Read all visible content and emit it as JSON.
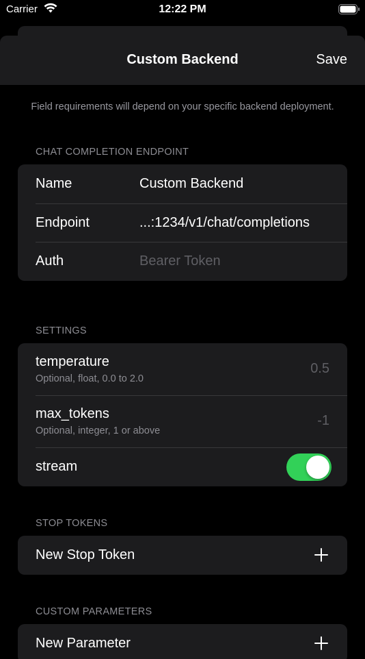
{
  "status_bar": {
    "carrier": "Carrier",
    "time": "12:22 PM"
  },
  "nav": {
    "title": "Custom Backend",
    "save_label": "Save"
  },
  "note": "Field requirements will depend on your specific backend deployment.",
  "endpoint_section": {
    "header": "CHAT COMPLETION ENDPOINT",
    "rows": [
      {
        "label": "Name",
        "value": "Custom Backend"
      },
      {
        "label": "Endpoint",
        "value": "...:1234/v1/chat/completions"
      },
      {
        "label": "Auth",
        "placeholder": "Bearer Token"
      }
    ]
  },
  "settings_section": {
    "header": "SETTINGS",
    "temperature": {
      "title": "temperature",
      "subtitle": "Optional, float, 0.0 to 2.0",
      "placeholder": "0.5"
    },
    "max_tokens": {
      "title": "max_tokens",
      "subtitle": "Optional, integer, 1 or above",
      "placeholder": "-1"
    },
    "stream": {
      "title": "stream",
      "enabled": true
    }
  },
  "stop_tokens_section": {
    "header": "STOP TOKENS",
    "add_label": "New Stop Token"
  },
  "custom_params_section": {
    "header": "CUSTOM PARAMETERS",
    "add_label": "New Parameter"
  },
  "colors": {
    "accent_toggle": "#32d158",
    "group_bg": "#1c1c1e",
    "secondary_text": "#8d8d93"
  }
}
